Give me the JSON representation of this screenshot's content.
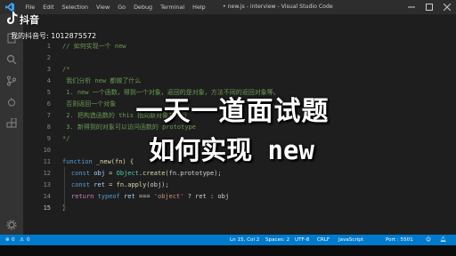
{
  "menu": [
    "File",
    "Edit",
    "Selection",
    "View",
    "Go",
    "Debug",
    "Terminal",
    "Help"
  ],
  "window_title": "• new.js - interview - Visual Studio Code",
  "watermark": {
    "logo_text": "抖音",
    "account_id": "我的抖音号: 1012875572"
  },
  "line_numbers": [
    "1",
    "2",
    "3",
    "4",
    "5",
    "6",
    "7",
    "8",
    "9",
    "10",
    "11",
    "12",
    "13",
    "14",
    "15"
  ],
  "code": {
    "l1": "// 如何实现一个 new",
    "l3": "/*",
    "l4": " 我们分析 new 都做了什么",
    "l5": " 1. new 一个函数，得到一个对象，返回的是对象，方法不同的返回对象等。",
    "l6": " 否则返回一个对象",
    "l7": " 2. 把构造函数的 this 指向新对象并执行",
    "l8": " 3. 新得到的对象可以访问函数的 prototype",
    "l9": "*/",
    "l11_kw": "function",
    "l11_rest": " _new(fn) {",
    "l12_kw": "const",
    "l12_var": "obj",
    "l12_eq": " = ",
    "l12_cls": "Object",
    "l12_fn": ".create",
    "l12_args": "(fn.prototype);",
    "l13_kw": "const",
    "l13_var": "ret",
    "l13_eq": " = ",
    "l13_fn": "fn.apply",
    "l13_args": "(obj);",
    "l14_kw": "return",
    "l14_kw2": "typeof",
    "l14_var": "ret",
    "l14_op": " === ",
    "l14_str": "'object'",
    "l14_rest": " ? ret : obj",
    "l15": "}"
  },
  "overlay": {
    "title": "一天一道面试题",
    "subtitle": "如何实现 new"
  },
  "status": {
    "errors": "0",
    "warnings": "0",
    "position": "Ln 15, Col 2",
    "spaces": "Spaces: 2",
    "encoding": "UTF-8",
    "eol": "CRLF",
    "language": "JavaScript",
    "port": "Port : 5501"
  },
  "colors": {
    "accent": "#007acc",
    "background": "#1e1e1e"
  }
}
